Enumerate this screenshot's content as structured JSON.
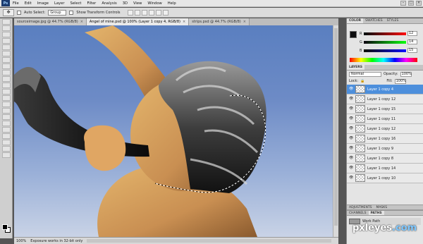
{
  "menubar": {
    "items": [
      "File",
      "Edit",
      "Image",
      "Layer",
      "Select",
      "Filter",
      "Analysis",
      "3D",
      "View",
      "Window",
      "Help"
    ]
  },
  "options": {
    "auto_select_label": "Auto Select:",
    "auto_select_value": "Group",
    "transform_label": "Show Transform Controls"
  },
  "tabs": [
    {
      "label": "sourceimage.jpg @ 44.7% (RGB/8)",
      "active": false
    },
    {
      "label": "Angel of mine.psd @ 100% (Layer 1 copy 4, RGB/8)",
      "active": true
    },
    {
      "label": "strips.psd @ 44.7% (RGB/8)",
      "active": false
    }
  ],
  "status": {
    "zoom": "100%",
    "message": "Exposure works in 32-bit only"
  },
  "color_panel": {
    "tabs": [
      "COLOR",
      "SWATCHES",
      "STYLES"
    ],
    "r": "12",
    "g": "14",
    "b": "15"
  },
  "layers_panel": {
    "title": "LAYERS",
    "blend_mode": "Normal",
    "opacity_label": "Opacity:",
    "opacity": "100%",
    "lock_label": "Lock:",
    "fill_label": "Fill:",
    "fill": "100%",
    "layers": [
      {
        "name": "Layer 1 copy 4",
        "active": true
      },
      {
        "name": "Layer 1 copy 12",
        "active": false
      },
      {
        "name": "Layer 1 copy 15",
        "active": false
      },
      {
        "name": "Layer 1 copy 11",
        "active": false
      },
      {
        "name": "Layer 1 copy 12",
        "active": false
      },
      {
        "name": "Layer 1 copy 16",
        "active": false
      },
      {
        "name": "Layer 1 copy 9",
        "active": false
      },
      {
        "name": "Layer 1 copy 8",
        "active": false
      },
      {
        "name": "Layer 1 copy 14",
        "active": false
      },
      {
        "name": "Layer 1 copy 10",
        "active": false
      }
    ]
  },
  "adjust_tabs": [
    "ADJUSTMENTS",
    "MASKS"
  ],
  "paths_tabs": [
    "CHANNELS",
    "PATHS"
  ],
  "paths": {
    "item": "Work Path"
  },
  "watermark": {
    "text": "pxleyes",
    "suffix": ".com"
  }
}
